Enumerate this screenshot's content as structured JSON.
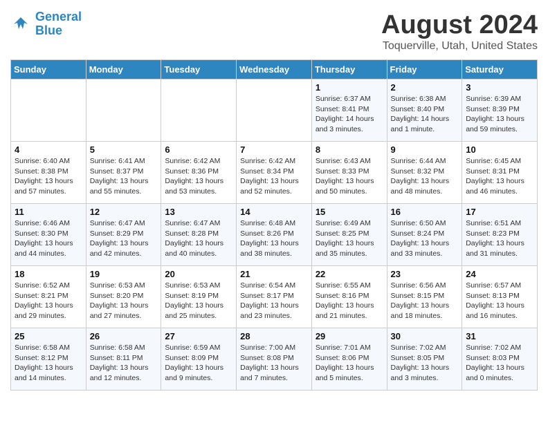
{
  "logo": {
    "text_general": "General",
    "text_blue": "Blue"
  },
  "header": {
    "month_year": "August 2024",
    "location": "Toquerville, Utah, United States"
  },
  "weekdays": [
    "Sunday",
    "Monday",
    "Tuesday",
    "Wednesday",
    "Thursday",
    "Friday",
    "Saturday"
  ],
  "weeks": [
    [
      {
        "day": "",
        "info": ""
      },
      {
        "day": "",
        "info": ""
      },
      {
        "day": "",
        "info": ""
      },
      {
        "day": "",
        "info": ""
      },
      {
        "day": "1",
        "info": "Sunrise: 6:37 AM\nSunset: 8:41 PM\nDaylight: 14 hours\nand 3 minutes."
      },
      {
        "day": "2",
        "info": "Sunrise: 6:38 AM\nSunset: 8:40 PM\nDaylight: 14 hours\nand 1 minute."
      },
      {
        "day": "3",
        "info": "Sunrise: 6:39 AM\nSunset: 8:39 PM\nDaylight: 13 hours\nand 59 minutes."
      }
    ],
    [
      {
        "day": "4",
        "info": "Sunrise: 6:40 AM\nSunset: 8:38 PM\nDaylight: 13 hours\nand 57 minutes."
      },
      {
        "day": "5",
        "info": "Sunrise: 6:41 AM\nSunset: 8:37 PM\nDaylight: 13 hours\nand 55 minutes."
      },
      {
        "day": "6",
        "info": "Sunrise: 6:42 AM\nSunset: 8:36 PM\nDaylight: 13 hours\nand 53 minutes."
      },
      {
        "day": "7",
        "info": "Sunrise: 6:42 AM\nSunset: 8:34 PM\nDaylight: 13 hours\nand 52 minutes."
      },
      {
        "day": "8",
        "info": "Sunrise: 6:43 AM\nSunset: 8:33 PM\nDaylight: 13 hours\nand 50 minutes."
      },
      {
        "day": "9",
        "info": "Sunrise: 6:44 AM\nSunset: 8:32 PM\nDaylight: 13 hours\nand 48 minutes."
      },
      {
        "day": "10",
        "info": "Sunrise: 6:45 AM\nSunset: 8:31 PM\nDaylight: 13 hours\nand 46 minutes."
      }
    ],
    [
      {
        "day": "11",
        "info": "Sunrise: 6:46 AM\nSunset: 8:30 PM\nDaylight: 13 hours\nand 44 minutes."
      },
      {
        "day": "12",
        "info": "Sunrise: 6:47 AM\nSunset: 8:29 PM\nDaylight: 13 hours\nand 42 minutes."
      },
      {
        "day": "13",
        "info": "Sunrise: 6:47 AM\nSunset: 8:28 PM\nDaylight: 13 hours\nand 40 minutes."
      },
      {
        "day": "14",
        "info": "Sunrise: 6:48 AM\nSunset: 8:26 PM\nDaylight: 13 hours\nand 38 minutes."
      },
      {
        "day": "15",
        "info": "Sunrise: 6:49 AM\nSunset: 8:25 PM\nDaylight: 13 hours\nand 35 minutes."
      },
      {
        "day": "16",
        "info": "Sunrise: 6:50 AM\nSunset: 8:24 PM\nDaylight: 13 hours\nand 33 minutes."
      },
      {
        "day": "17",
        "info": "Sunrise: 6:51 AM\nSunset: 8:23 PM\nDaylight: 13 hours\nand 31 minutes."
      }
    ],
    [
      {
        "day": "18",
        "info": "Sunrise: 6:52 AM\nSunset: 8:21 PM\nDaylight: 13 hours\nand 29 minutes."
      },
      {
        "day": "19",
        "info": "Sunrise: 6:53 AM\nSunset: 8:20 PM\nDaylight: 13 hours\nand 27 minutes."
      },
      {
        "day": "20",
        "info": "Sunrise: 6:53 AM\nSunset: 8:19 PM\nDaylight: 13 hours\nand 25 minutes."
      },
      {
        "day": "21",
        "info": "Sunrise: 6:54 AM\nSunset: 8:17 PM\nDaylight: 13 hours\nand 23 minutes."
      },
      {
        "day": "22",
        "info": "Sunrise: 6:55 AM\nSunset: 8:16 PM\nDaylight: 13 hours\nand 21 minutes."
      },
      {
        "day": "23",
        "info": "Sunrise: 6:56 AM\nSunset: 8:15 PM\nDaylight: 13 hours\nand 18 minutes."
      },
      {
        "day": "24",
        "info": "Sunrise: 6:57 AM\nSunset: 8:13 PM\nDaylight: 13 hours\nand 16 minutes."
      }
    ],
    [
      {
        "day": "25",
        "info": "Sunrise: 6:58 AM\nSunset: 8:12 PM\nDaylight: 13 hours\nand 14 minutes."
      },
      {
        "day": "26",
        "info": "Sunrise: 6:58 AM\nSunset: 8:11 PM\nDaylight: 13 hours\nand 12 minutes."
      },
      {
        "day": "27",
        "info": "Sunrise: 6:59 AM\nSunset: 8:09 PM\nDaylight: 13 hours\nand 9 minutes."
      },
      {
        "day": "28",
        "info": "Sunrise: 7:00 AM\nSunset: 8:08 PM\nDaylight: 13 hours\nand 7 minutes."
      },
      {
        "day": "29",
        "info": "Sunrise: 7:01 AM\nSunset: 8:06 PM\nDaylight: 13 hours\nand 5 minutes."
      },
      {
        "day": "30",
        "info": "Sunrise: 7:02 AM\nSunset: 8:05 PM\nDaylight: 13 hours\nand 3 minutes."
      },
      {
        "day": "31",
        "info": "Sunrise: 7:02 AM\nSunset: 8:03 PM\nDaylight: 13 hours\nand 0 minutes."
      }
    ]
  ]
}
